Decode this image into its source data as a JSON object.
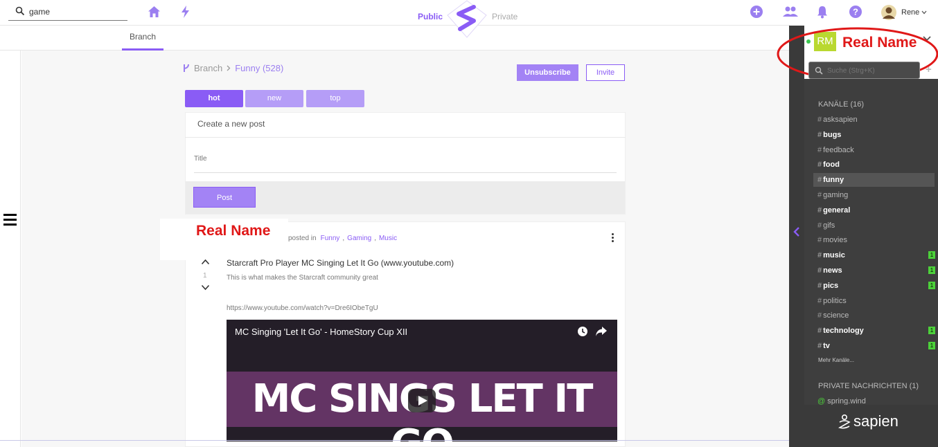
{
  "header": {
    "search_value": "game",
    "tab_public": "Public",
    "tab_private": "Private",
    "user_name": "Rene"
  },
  "subnav": {
    "branch_tab": "Branch"
  },
  "branch": {
    "crumb_root": "Branch",
    "crumb_current": "Funny (528)",
    "unsubscribe_label": "Unsubscribe",
    "invite_label": "Invite"
  },
  "sort": {
    "hot": "hot",
    "new": "new",
    "top": "top"
  },
  "create_post": {
    "heading": "Create a new post",
    "title_placeholder": "Title",
    "post_label": "Post"
  },
  "post": {
    "author_annotation": "Real Name",
    "posted_in_label": "posted in",
    "categories": [
      "Funny",
      "Gaming",
      "Music"
    ],
    "vote_count": "1",
    "title": "Starcraft Pro Player MC Singing Let It Go (www.youtube.com)",
    "description": "This is what makes the Starcraft community great",
    "link": "https://www.youtube.com/watch?v=Dre6IObeTgU",
    "video_title": "MC Singing 'Let It Go' - HomeStory Cup XII",
    "video_overlay": "MC SINGS LET IT GO"
  },
  "sidebar": {
    "avatar_initials": "RM",
    "name_annotation": "Real Name",
    "search_placeholder": "Suche (Strg+K)",
    "channels_heading": "KANÄLE (16)",
    "channels": [
      {
        "name": "asksapien",
        "bold": false,
        "badge": ""
      },
      {
        "name": "bugs",
        "bold": true,
        "badge": ""
      },
      {
        "name": "feedback",
        "bold": false,
        "badge": ""
      },
      {
        "name": "food",
        "bold": true,
        "badge": ""
      },
      {
        "name": "funny",
        "bold": true,
        "badge": "",
        "active": true
      },
      {
        "name": "gaming",
        "bold": false,
        "badge": ""
      },
      {
        "name": "general",
        "bold": true,
        "badge": ""
      },
      {
        "name": "gifs",
        "bold": false,
        "badge": ""
      },
      {
        "name": "movies",
        "bold": false,
        "badge": ""
      },
      {
        "name": "music",
        "bold": true,
        "badge": "1"
      },
      {
        "name": "news",
        "bold": true,
        "badge": "1"
      },
      {
        "name": "pics",
        "bold": true,
        "badge": "1"
      },
      {
        "name": "politics",
        "bold": false,
        "badge": ""
      },
      {
        "name": "science",
        "bold": false,
        "badge": ""
      },
      {
        "name": "technology",
        "bold": true,
        "badge": "1"
      },
      {
        "name": "tv",
        "bold": true,
        "badge": "1"
      }
    ],
    "more_channels": "Mehr Kanäle...",
    "private_heading": "PRIVATE NACHRICHTEN (1)",
    "private_item": "spring.wind",
    "brand": "sapien"
  },
  "colors": {
    "accent": "#8a5cf5",
    "accent_light": "#b59df7",
    "sidebar_bg": "#3e3e3e",
    "annotation_red": "#e01818",
    "badge_green": "#4cd13a"
  }
}
